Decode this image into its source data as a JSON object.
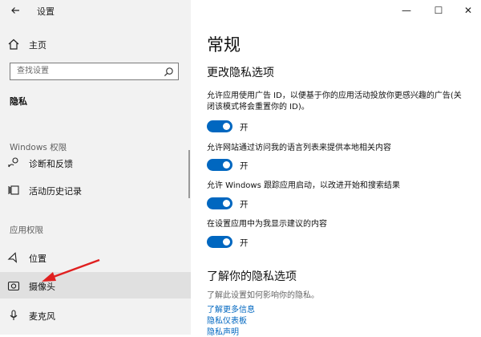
{
  "window": {
    "title": "设置",
    "controls": {
      "minimize": "—",
      "maximize": "☐",
      "close": "✕"
    }
  },
  "sidebar": {
    "back_icon": "back-arrow-icon",
    "home_label": "主页",
    "search_placeholder": "查找设置",
    "section_title": "隐私",
    "groups": [
      {
        "label": "Windows 权限",
        "items": [
          {
            "label": "诊断和反馈",
            "icon": "diagnostics-icon"
          },
          {
            "label": "活动历史记录",
            "icon": "activity-history-icon"
          }
        ]
      },
      {
        "label": "应用权限",
        "items": [
          {
            "label": "位置",
            "icon": "location-icon"
          },
          {
            "label": "摄像头",
            "icon": "camera-icon",
            "selected": true
          },
          {
            "label": "麦克风",
            "icon": "microphone-icon"
          }
        ]
      }
    ]
  },
  "main": {
    "page_title": "常规",
    "section_title": "更改隐私选项",
    "options": [
      {
        "text": "允许应用使用广告 ID，以便基于你的应用活动投放你更感兴趣的广告(关闭该模式将会重置你的 ID)。",
        "state": "开",
        "on": true
      },
      {
        "text": "允许网站通过访问我的语言列表来提供本地相关内容",
        "state": "开",
        "on": true
      },
      {
        "text": "允许 Windows 跟踪应用启动，以改进开始和搜索结果",
        "state": "开",
        "on": true
      },
      {
        "text": "在设置应用中为我显示建议的内容",
        "state": "开",
        "on": true
      }
    ],
    "learn": {
      "title": "了解你的隐私选项",
      "subtitle": "了解此设置如何影响你的隐私。",
      "links": [
        "了解更多信息",
        "隐私仪表板",
        "隐私声明"
      ]
    }
  },
  "colors": {
    "accent": "#0067c0",
    "sidebar_bg": "#f2f2f2",
    "selected_bg": "#e0e0e0",
    "annotation_arrow": "#e02020"
  }
}
